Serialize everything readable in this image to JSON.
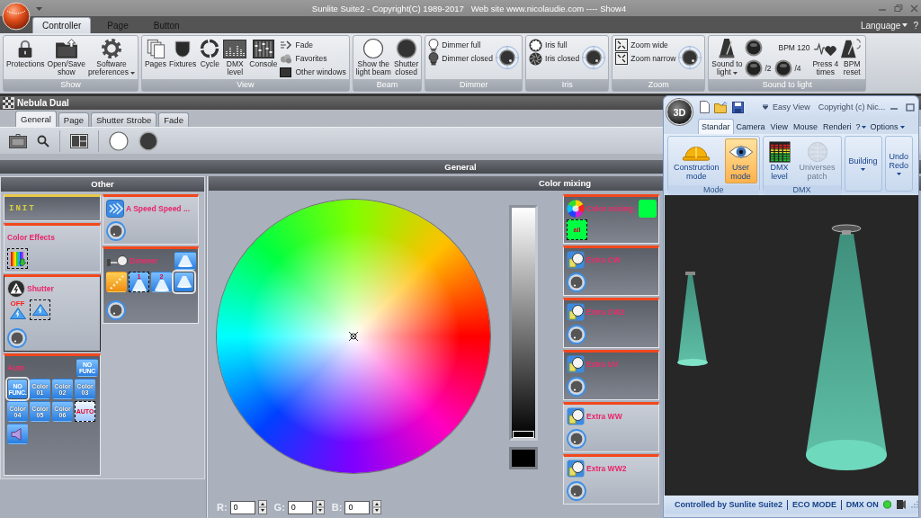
{
  "window": {
    "title": "Sunlite Suite2 - Copyright(C) 1989-2017   Web site www.nicolaudie.com ---- Show4"
  },
  "ribbon_tabs": [
    {
      "label": "Controller",
      "selected": true
    },
    {
      "label": "Page",
      "selected": false
    },
    {
      "label": "Button",
      "selected": false
    }
  ],
  "language": {
    "label": "Language"
  },
  "help": "?",
  "ribbon_groups": [
    {
      "title": "Show",
      "items": [
        {
          "kind": "large",
          "label": "Protections",
          "dropdown": false
        },
        {
          "kind": "large",
          "label": "Open/Save show",
          "dropdown": false
        },
        {
          "kind": "large",
          "label": "Software preferences",
          "dropdown": true
        }
      ]
    },
    {
      "title": "View",
      "items": [
        {
          "kind": "large",
          "label": "Pages"
        },
        {
          "kind": "large",
          "label": "Fixtures"
        },
        {
          "kind": "large",
          "label": "Cycle"
        },
        {
          "kind": "large",
          "label": "DMX level"
        },
        {
          "kind": "large",
          "label": "Console"
        },
        {
          "kind": "small",
          "label": "Fade"
        },
        {
          "kind": "small",
          "label": "Favorites"
        },
        {
          "kind": "small",
          "label": "Other windows"
        }
      ]
    },
    {
      "title": "Beam",
      "items": [
        {
          "kind": "large",
          "label": "Show the light beam"
        },
        {
          "kind": "large",
          "label": "Shutter closed"
        }
      ]
    },
    {
      "title": "Dimmer",
      "items": [
        {
          "kind": "small",
          "label": "Dimmer full"
        },
        {
          "kind": "small",
          "label": "Dimmer closed"
        },
        {
          "kind": "knob"
        }
      ]
    },
    {
      "title": "Iris",
      "items": [
        {
          "kind": "small",
          "label": "Iris full"
        },
        {
          "kind": "small",
          "label": "Iris closed"
        },
        {
          "kind": "knob"
        }
      ]
    },
    {
      "title": "Zoom",
      "items": [
        {
          "kind": "small",
          "label": "Zoom wide"
        },
        {
          "kind": "small",
          "label": "Zoom narrow"
        },
        {
          "kind": "knob"
        }
      ]
    },
    {
      "title": "Sound to light",
      "items": [
        {
          "kind": "large",
          "label": "Sound to light",
          "dropdown": true
        },
        {
          "kind": "cluster",
          "items": [
            {
              "kind": "led"
            },
            {
              "kind": "text",
              "label": "BPM 120"
            },
            {
              "kind": "led",
              "label": "/2"
            },
            {
              "kind": "led",
              "label": "/4"
            }
          ]
        },
        {
          "kind": "large",
          "label": "Press 4 times",
          "dropdown": false
        },
        {
          "kind": "large",
          "label": "BPM reset",
          "dropdown": false
        }
      ]
    }
  ],
  "panel": {
    "title": "Nebula Dual",
    "tabs": [
      {
        "label": "General",
        "selected": true
      },
      {
        "label": "Page",
        "selected": false
      },
      {
        "label": "Shutter Strobe",
        "selected": false
      },
      {
        "label": "Fade",
        "selected": false
      }
    ],
    "section": "General"
  },
  "other": {
    "title": "Other",
    "columns": [
      [
        {
          "title": "INIT",
          "kind": "init",
          "active": true,
          "selected": false,
          "knob": false
        },
        {
          "title": "Color Effects",
          "kind": "effects",
          "active": false,
          "selected": false,
          "knob": false,
          "tiles": [
            {
              "kind": "spectrum",
              "selected": false,
              "flagged": true
            }
          ]
        },
        {
          "title": "Shutter",
          "kind": "shutter",
          "active": false,
          "selected": true,
          "knob": true,
          "tiles": [
            {
              "kind": "strobe",
              "label": "OFF",
              "selected": false,
              "flagged": false
            },
            {
              "kind": "strobe",
              "selected": false,
              "flagged": true
            }
          ]
        },
        {
          "title": "Auto",
          "kind": "auto",
          "active": true,
          "selected": false,
          "knob": false,
          "corner": {
            "kind": "nofunc",
            "label": "NO FUNC"
          },
          "tiles": [
            {
              "kind": "nofunc",
              "label": "NO FUNC.",
              "selected": true,
              "flagged": false
            },
            {
              "kind": "color",
              "label": "Color 01",
              "selected": false,
              "flagged": false
            },
            {
              "kind": "color",
              "label": "Color 02",
              "selected": false,
              "flagged": false
            },
            {
              "kind": "color",
              "label": "Color 03",
              "selected": false,
              "flagged": false
            },
            {
              "kind": "color",
              "label": "Color 04",
              "selected": false,
              "flagged": false
            },
            {
              "kind": "color",
              "label": "Color 05",
              "selected": false,
              "flagged": false
            },
            {
              "kind": "color",
              "label": "Color 06",
              "selected": false,
              "flagged": false
            },
            {
              "kind": "auto",
              "label": "AUTO",
              "selected": false,
              "flagged": true
            },
            {
              "kind": "sound",
              "selected": false,
              "flagged": false
            }
          ]
        }
      ],
      [
        {
          "title": "A Speed Speed ...",
          "kind": "speed",
          "active": false,
          "selected": false,
          "knob": true
        },
        {
          "title": "Dimmer",
          "kind": "dimmer",
          "active": true,
          "selected": false,
          "knob": true,
          "corner": {
            "kind": "beam"
          },
          "tiles": [
            {
              "kind": "ramp",
              "selected": false,
              "flagged": false
            },
            {
              "kind": "beam",
              "label": "1",
              "selected": false,
              "flagged": true
            },
            {
              "kind": "beam",
              "label": "2",
              "selected": false,
              "flagged": false
            },
            {
              "kind": "beam",
              "selected": true,
              "flagged": false
            }
          ]
        }
      ]
    ]
  },
  "color_mixing": {
    "title": "Color mixing",
    "brightness": {
      "level": 0
    },
    "rgb": [
      {
        "label": "R:",
        "value": "0"
      },
      {
        "label": "G:",
        "value": "0"
      },
      {
        "label": "B:",
        "value": "0"
      }
    ],
    "cards": [
      {
        "title": "Color mixing",
        "kind": "colormix",
        "active": true,
        "selected": false,
        "knob": false,
        "corner": {
          "kind": "swatch"
        },
        "tiles": [
          {
            "kind": "swatch",
            "label": "all",
            "selected": false,
            "flagged": true
          }
        ]
      },
      {
        "title": "Extra CW",
        "kind": "extra",
        "active": true,
        "selected": false,
        "knob": true
      },
      {
        "title": "Extra CW2",
        "kind": "extra",
        "active": true,
        "selected": false,
        "knob": true
      },
      {
        "title": "Extra UV",
        "kind": "extra",
        "active": true,
        "selected": false,
        "knob": true
      },
      {
        "title": "Extra WW",
        "kind": "extra",
        "active": false,
        "selected": false,
        "knob": true
      },
      {
        "title": "Extra WW2",
        "kind": "extra",
        "active": false,
        "selected": false,
        "knob": true
      }
    ]
  },
  "easy_view": {
    "logo": "3D",
    "title": "Easy View",
    "subtitle": "Copyright (c) Nic...",
    "tabs": [
      {
        "label": "Standar",
        "selected": true
      },
      {
        "label": "Camera",
        "selected": false
      },
      {
        "label": "View",
        "selected": false
      },
      {
        "label": "Mouse",
        "selected": false
      },
      {
        "label": "Renderi",
        "selected": false
      }
    ],
    "help": "?",
    "options": "Options",
    "groups": [
      {
        "title": "Mode",
        "items": [
          {
            "label": "Construction mode",
            "selected": false,
            "disabled": false
          },
          {
            "label": "User mode",
            "selected": true,
            "disabled": false
          }
        ]
      },
      {
        "title": "DMX",
        "items": [
          {
            "label": "DMX level",
            "selected": false,
            "disabled": false
          },
          {
            "label": "Universes patch",
            "selected": false,
            "disabled": true
          }
        ]
      }
    ],
    "menus": [
      {
        "label": "Building"
      },
      {
        "label": "Undo Redo"
      }
    ],
    "status": [
      {
        "text": "Controlled by Sunlite Suite2",
        "led": false
      },
      {
        "text": "ECO MODE",
        "led": false
      },
      {
        "text": "DMX ON",
        "led": true
      }
    ]
  }
}
